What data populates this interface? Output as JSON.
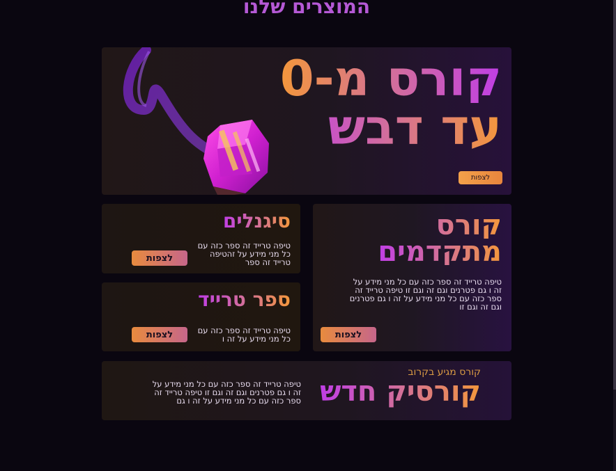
{
  "page": {
    "section_title": "המוצרים שלנו"
  },
  "hero": {
    "title_line1": "קורס מ-0",
    "title_line2": "עד דבש",
    "button_label": "לצפות"
  },
  "advanced": {
    "title_line1": "קורס",
    "title_line2": "מתקדמים",
    "description": "טיפה טרייד זה ספר כזה עם כל מני מידע על זה ו גם פטרנים וגם זה וגם זו טיפה טרייד זה ספר כזה עם כל מני מידע על זה ו גם פטרנים וגם זה וגם זו",
    "button_label": "לצפות"
  },
  "signals": {
    "title": "סיגנלים",
    "description": "טיפה טרייד זה ספר כזה עם כל מני מידע על זהטיפה טרייד זה ספר",
    "button_label": "לצפות"
  },
  "tradebook": {
    "title": "ספר טרייד",
    "description": "טיפה טרייד זה ספר כזה עם כל מני מידע על זה ו",
    "button_label": "לצפות"
  },
  "newcourse": {
    "kicker": "קורס מגיע בקרוב",
    "title": "קורסיק חדש",
    "description": "טיפה טרייד זה ספר כזה עם כל מני מידע על זה ו גם פטרנים וגם זה וגם זו טיפה טרייד זה ספר כזה עם כל מני מידע על זה ו גם"
  },
  "colors": {
    "background": "#0a0610",
    "accent_purple": "#c03ee6",
    "accent_orange": "#f3973b",
    "button_orange": "#e88b3e"
  },
  "icons": {
    "hero_art": "crystal-gem-icon"
  }
}
